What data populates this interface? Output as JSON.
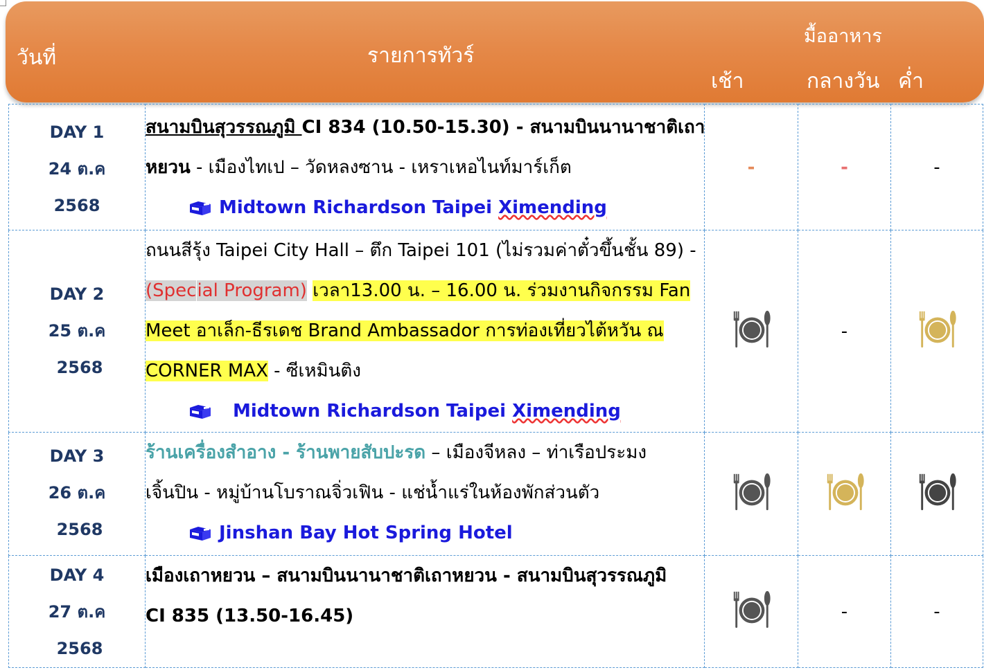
{
  "header": {
    "day_label": "วันที่",
    "program_label": "รายการทัวร์",
    "meals_label": "มื้ออาหาร",
    "breakfast_label": "เช้า",
    "lunch_label": "กลางวัน",
    "dinner_label": "ค่ำ"
  },
  "colors": {
    "header_orange": "#e58949",
    "border_blue": "#5b9bd5",
    "day_navy": "#1f3864",
    "hotel_blue": "#1a1adc",
    "highlight_yellow": "#ffff4d",
    "plate_dark": "#555555",
    "plate_gold": "#d4b45a"
  },
  "days": [
    {
      "day": "DAY 1",
      "date": "24 ต.ค",
      "year": "2568",
      "l1_a": "สนามบินสุวรรณภูมิ ",
      "l1_b": " CI 834 (10.50-15.30) - สนามบินนานาชาติเถา",
      "l2_a": "หยวน",
      "l2_b": "  - เมืองไทเป – วัดหลงซาน - เหราเหอไนท์มาร์เก็ต",
      "hotel_a": "Midtown Richardson Taipei ",
      "hotel_b": "Ximending",
      "breakfast": "-",
      "lunch": "-",
      "dinner": "-"
    },
    {
      "day": "DAY 2",
      "date": "25 ต.ค",
      "year": "2568",
      "l1": "ถนนสีรุ้ง Taipei City Hall – ตึก Taipei 101 (ไม่รวมค่าตั๋วขึ้นชั้น 89) -",
      "l2_a": "(Spec",
      "l2_b": "ial Program)",
      "l2_c": " ",
      "l2_d": "เวลา13.00 น. – 16.00 น. ร่วมงานกิจกรรม Fan",
      "l3": "Meet อาเล็ก-ธีรเดช Brand Ambassador การท่องเที่ยวไต้หวัน ณ",
      "l4_a": "CORNER MAX",
      "l4_b": " - ซีเหมินติง",
      "hotel_a": "Midtown Richardson Taipei ",
      "hotel_b": "Ximending",
      "breakfast_icon": "plate-icon",
      "lunch": "-",
      "dinner_icon": "plate-icon"
    },
    {
      "day": "DAY 3",
      "date": "26 ต.ค",
      "year": "2568",
      "l1_a": "ร้านเครื่องสำอาง - ร้านพายสับปะรด",
      "l1_b": " – เมืองจีหลง – ท่าเรือประมง",
      "l2": "เจิ้นปิน - หมู่บ้านโบราณจิ่วเฟิน - แช่น้ำแร่ในห้องพักส่วนตัว",
      "hotel": "Jinshan Bay Hot Spring Hotel",
      "breakfast_icon": "plate-icon",
      "lunch_icon": "plate-icon",
      "dinner_icon": "plate-icon"
    },
    {
      "day": "DAY 4",
      "date": "27 ต.ค",
      "year": "2568",
      "l1": "เมืองเถาหยวน – สนามบินนานาชาติเถาหยวน - สนามบินสุวรรณภูมิ",
      "l2": "CI 835 (13.50-16.45)",
      "breakfast_icon": "plate-icon",
      "lunch": "-",
      "dinner": "-"
    }
  ]
}
